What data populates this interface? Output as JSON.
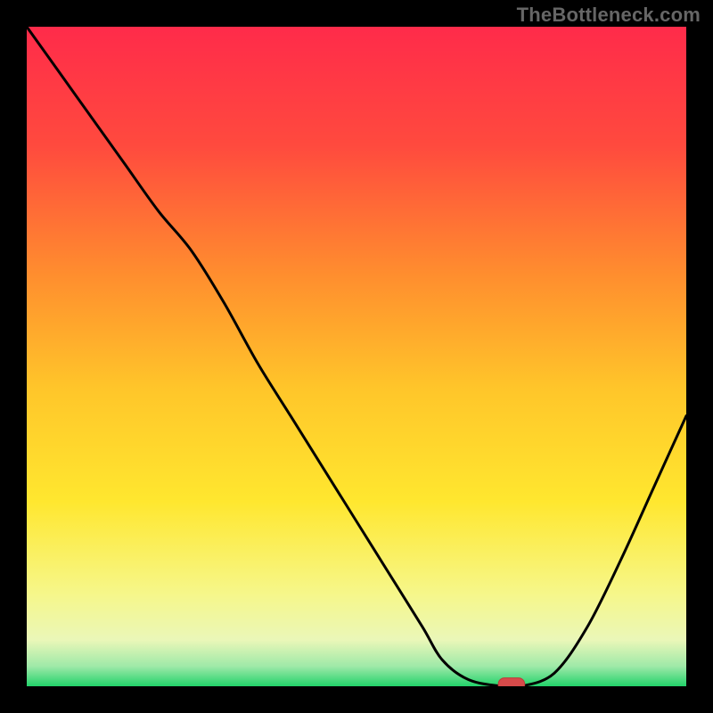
{
  "watermark": "TheBottleneck.com",
  "colors": {
    "gradient": [
      {
        "offset": "0%",
        "color": "#ff2b4a"
      },
      {
        "offset": "18%",
        "color": "#ff4a3e"
      },
      {
        "offset": "38%",
        "color": "#ff8f2e"
      },
      {
        "offset": "55%",
        "color": "#ffc62a"
      },
      {
        "offset": "72%",
        "color": "#ffe72f"
      },
      {
        "offset": "86%",
        "color": "#f6f78a"
      },
      {
        "offset": "93%",
        "color": "#eaf7b8"
      },
      {
        "offset": "97%",
        "color": "#9ee9a8"
      },
      {
        "offset": "100%",
        "color": "#22d36a"
      }
    ],
    "curve": "#000000",
    "marker": "#d64a4a"
  },
  "chart_data": {
    "type": "line",
    "title": "",
    "xlabel": "",
    "ylabel": "",
    "xlim": [
      0,
      100
    ],
    "ylim": [
      0,
      100
    ],
    "x": [
      0,
      5,
      10,
      15,
      20,
      25,
      30,
      35,
      40,
      45,
      50,
      55,
      60,
      63,
      67,
      72,
      75,
      80,
      85,
      90,
      95,
      100
    ],
    "values": [
      100,
      93,
      86,
      79,
      72,
      66,
      58,
      49,
      41,
      33,
      25,
      17,
      9,
      4,
      1,
      0,
      0,
      2,
      9,
      19,
      30,
      41
    ],
    "marker": {
      "x": 73.5,
      "y": 0,
      "width_x": 4,
      "height_y": 2
    }
  }
}
